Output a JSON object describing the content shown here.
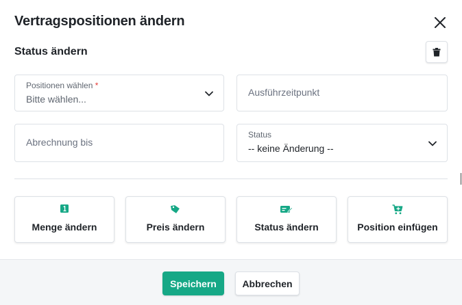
{
  "dialog": {
    "title": "Vertragspositionen ändern",
    "section_title": "Status ändern"
  },
  "form": {
    "positions": {
      "label": "Positionen wählen",
      "required_mark": "*",
      "value": "Bitte wählen..."
    },
    "execution_time": {
      "placeholder": "Ausführzeitpunkt"
    },
    "billing_until": {
      "placeholder": "Abrechnung bis"
    },
    "status": {
      "label": "Status",
      "value": "-- keine Änderung --"
    }
  },
  "actions": [
    {
      "label": "Menge ändern",
      "icon": "quantity-one-icon"
    },
    {
      "label": "Preis ändern",
      "icon": "price-tag-icon"
    },
    {
      "label": "Status ändern",
      "icon": "status-edit-icon"
    },
    {
      "label": "Position einfügen",
      "icon": "add-to-cart-icon"
    }
  ],
  "footer": {
    "save_label": "Speichern",
    "cancel_label": "Abbrechen"
  },
  "colors": {
    "accent": "#16a886",
    "required": "#e53935",
    "border": "#dde1e6",
    "footer_bg": "#f4f6f8"
  }
}
